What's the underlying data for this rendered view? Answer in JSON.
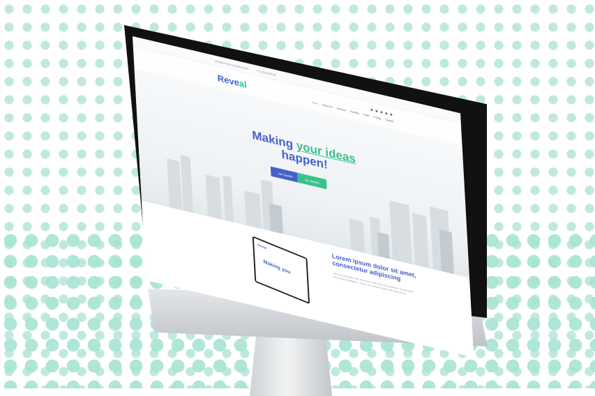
{
  "background": {
    "dot_color": "#bfe9de",
    "accent_dot_color": "#a6e3d3"
  },
  "website": {
    "topbar": {
      "email": "info@reveal-company.com",
      "phone": "+1 234 5678 90"
    },
    "logo": {
      "text_main": "Reve",
      "text_accent": "al"
    },
    "menu": [
      "Home",
      "About Us",
      "Services",
      "Portfolio",
      "Team",
      "Pricing",
      "Contact"
    ],
    "social_icons": [
      "twitter-icon",
      "facebook-icon",
      "instagram-icon",
      "google-plus-icon",
      "linkedin-icon"
    ],
    "hero": {
      "headline_part1": "Making",
      "headline_accent": "your ideas",
      "headline_part2": "happen!",
      "button_start": "Get Started",
      "button_more": "Get Started"
    },
    "about": {
      "title": "Lorem ipsum dolor sit amet, consectetur adipiscing",
      "body": "Sed ut perspiciatis unde omnis iste natus error sit voluptatem accusantium doloremque laudantium, totam rem aperiam eaque ipsa quae ab illo.",
      "laptop_logo": "Reveal",
      "laptop_headline": "Making you"
    },
    "colors": {
      "primary": "#4561c9",
      "accent": "#39c28c"
    }
  }
}
